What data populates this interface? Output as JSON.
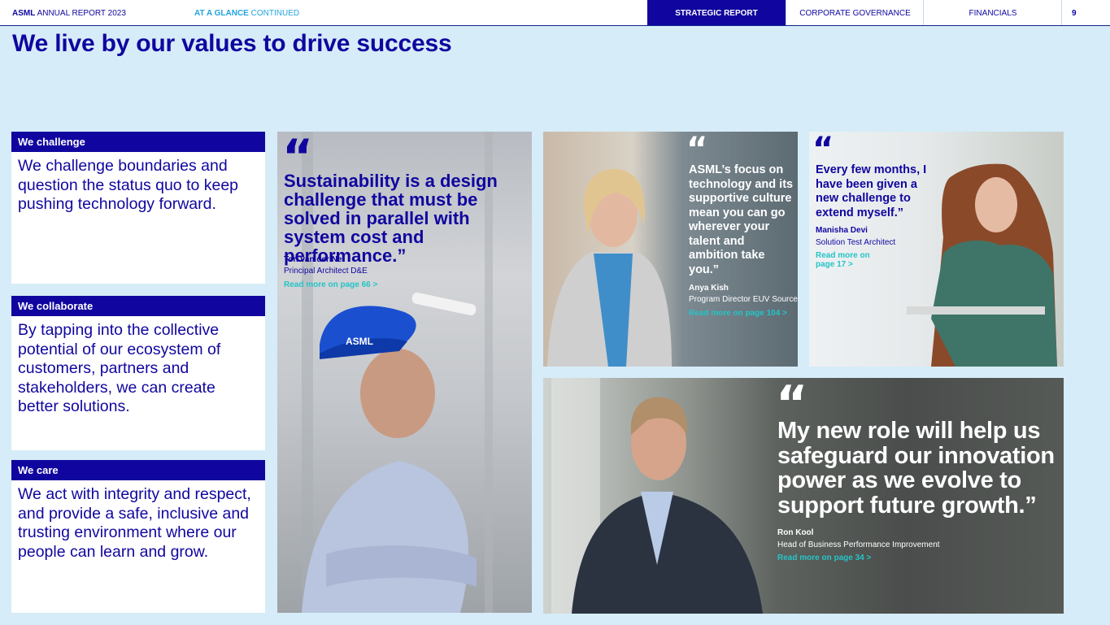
{
  "header": {
    "brand_bold": "ASML",
    "brand_rest": " ANNUAL REPORT 2023",
    "section_bold": "AT A GLANCE",
    "section_rest": " CONTINUED",
    "tabs": [
      {
        "label": "STRATEGIC REPORT",
        "active": true
      },
      {
        "label": "CORPORATE GOVERNANCE",
        "active": false
      },
      {
        "label": "FINANCIALS",
        "active": false
      }
    ],
    "page_number": "9"
  },
  "page_title": "We live by our values to drive success",
  "values": [
    {
      "heading": "We challenge",
      "text": "We challenge boundaries and question the status quo to keep pushing technology forward."
    },
    {
      "heading": "We collaborate",
      "text": "By tapping into the collective potential of our ecosystem of customers, partners and stakeholders, we can create better solutions."
    },
    {
      "heading": "We care",
      "text": "We act with integrity and respect, and provide a safe, inclusive and trusting environment where our people can learn and grow."
    }
  ],
  "quotes": [
    {
      "mark": "“",
      "text": "Sustainability is a design challenge that must be solved in parallel with system cost and performance.”",
      "name": "Ton van der Net",
      "role": "Principal Architect D&E",
      "link": "Read more on page 66 >"
    },
    {
      "mark": "“",
      "text": "ASML’s focus on technology and its supportive culture mean you can go wherever your talent and ambition take you.”",
      "name": "Anya Kish",
      "role": "Program Director EUV Source",
      "link": "Read more on page 104 >"
    },
    {
      "mark": "“",
      "text": "Every few months, I have been given a new challenge to extend myself.”",
      "name": "Manisha Devi",
      "role": "Solution Test Architect",
      "link": "Read more on page 17 >"
    },
    {
      "mark": "“",
      "text": "My new role will help us safeguard our innovation power as we evolve to support future growth.”",
      "name": "Ron Kool",
      "role": "Head of Business Performance Improvement",
      "link": "Read more on page 34 >"
    }
  ],
  "photo_labels": {
    "helmet_text": "ASML"
  },
  "colors": {
    "brand_blue": "#10069f",
    "accent_cyan": "#21a4e0",
    "link_teal": "#24c4c6",
    "background": "#d6ecf8"
  }
}
